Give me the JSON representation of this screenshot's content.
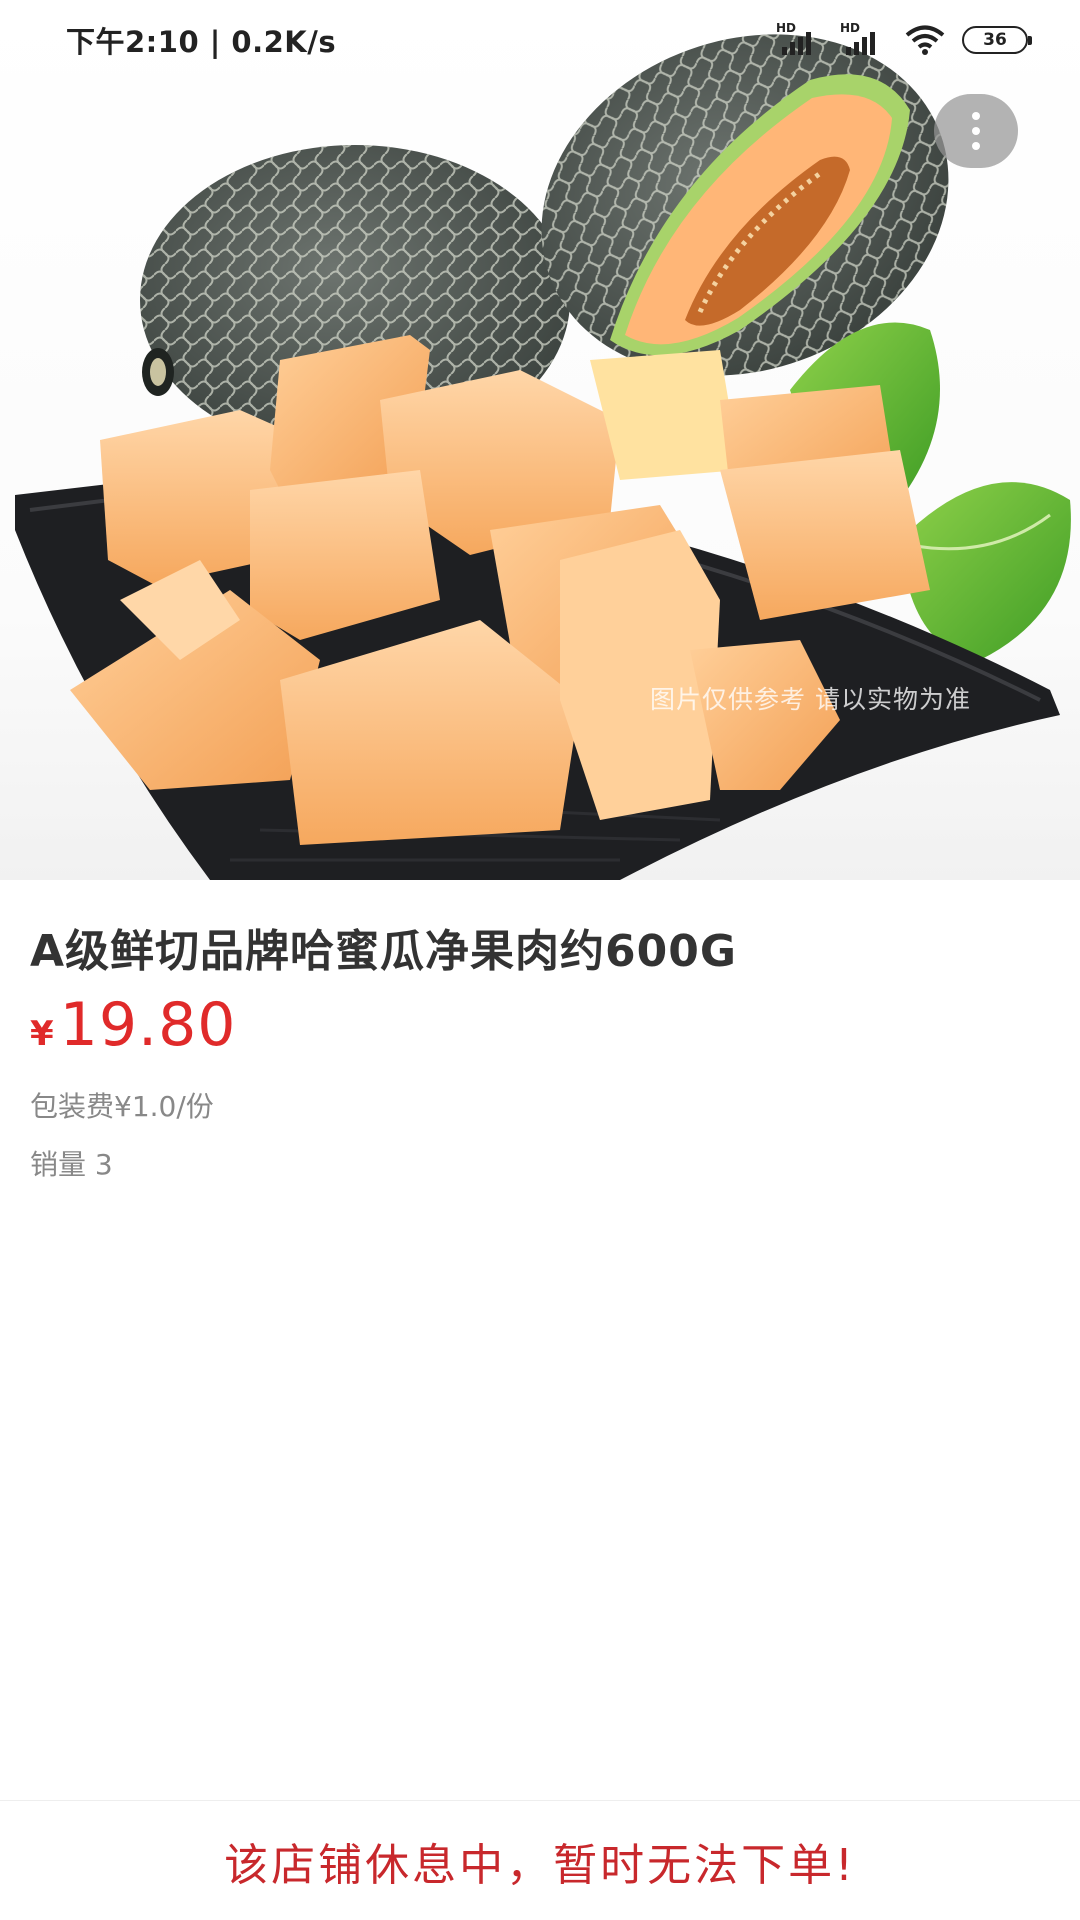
{
  "status_bar": {
    "time_speed": "下午2:10 | 0.2K/s",
    "sim1_label": "HD",
    "sim2_label": "HD",
    "battery": "36"
  },
  "product": {
    "image_watermark": "图片仅供参考 请以实物为准",
    "title": "A级鲜切品牌哈蜜瓜净果肉约600G",
    "currency": "¥",
    "price": "19.80",
    "packing_fee": "包装费¥1.0/份",
    "sales": "销量 3"
  },
  "footer": {
    "notice": "该店铺休息中，暂时无法下单!"
  },
  "colors": {
    "price": "#e02a2a",
    "notice": "#c8282c",
    "title": "#333333",
    "meta": "#888888"
  },
  "icons": [
    "more-icon",
    "signal-icon",
    "wifi-icon",
    "battery-icon"
  ]
}
